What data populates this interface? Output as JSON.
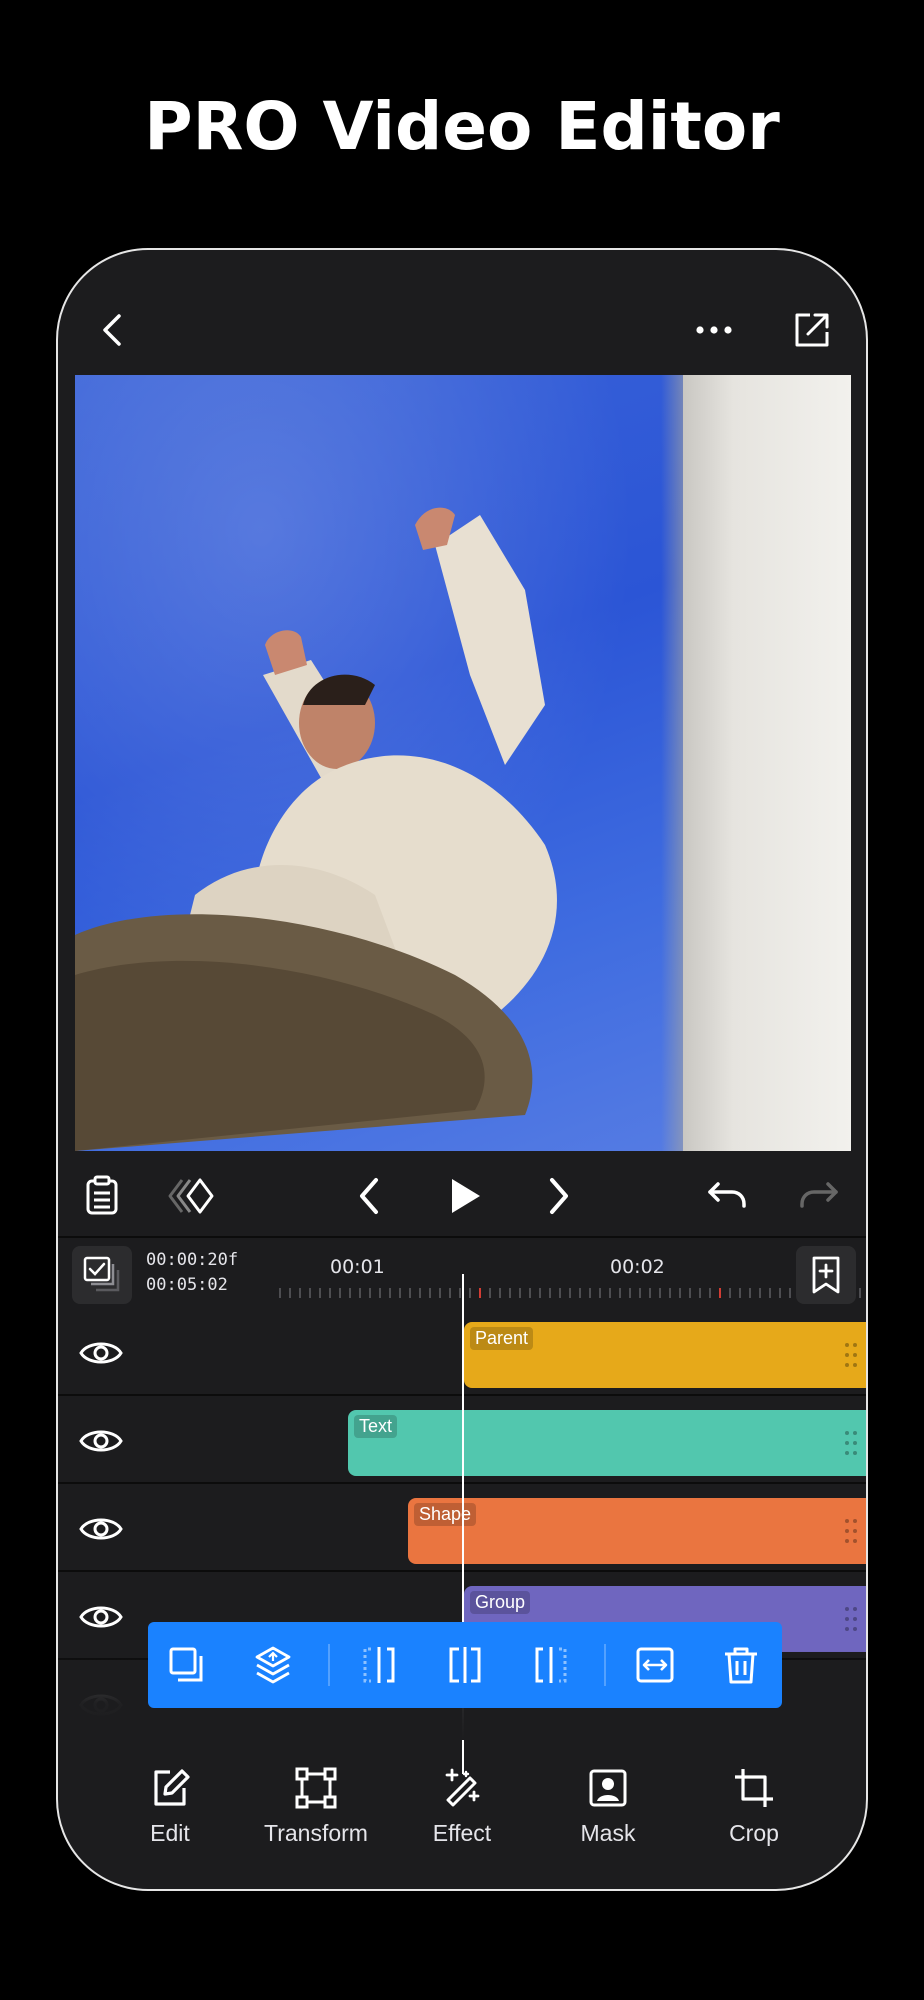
{
  "headline": "PRO Video Editor",
  "topbar": {
    "back_icon": "chevron-left-icon",
    "more_icon": "more-horizontal-icon",
    "share_icon": "export-share-icon"
  },
  "controls": {
    "clipboard_icon": "clipboard-icon",
    "keyframe_icon": "keyframe-diamond-icon",
    "prev_icon": "chevron-left-icon",
    "play_icon": "play-icon",
    "next_icon": "chevron-right-icon",
    "undo_icon": "undo-icon",
    "redo_icon": "redo-icon"
  },
  "ruler": {
    "current_time": "00:00:20f",
    "total_time": "00:05:02",
    "marks": [
      "00:01",
      "00:02"
    ]
  },
  "tracks": [
    {
      "label": "Parent",
      "color": "#e6a91a"
    },
    {
      "label": "Text",
      "color": "#52c7ae"
    },
    {
      "label": "Shape",
      "color": "#ea7540"
    },
    {
      "label": "Group",
      "color": "#6f66bf"
    }
  ],
  "selection_tools": [
    "duplicate-icon",
    "layer-order-icon",
    "trim-start-icon",
    "split-icon",
    "trim-end-icon",
    "fit-width-icon",
    "trash-icon"
  ],
  "bottom_tools": [
    {
      "label": "Edit",
      "icon": "edit-icon"
    },
    {
      "label": "Transform",
      "icon": "transform-icon"
    },
    {
      "label": "Effect",
      "icon": "magic-wand-icon"
    },
    {
      "label": "Mask",
      "icon": "mask-portrait-icon"
    },
    {
      "label": "Crop",
      "icon": "crop-icon"
    }
  ],
  "colors": {
    "accent": "#1a82ff",
    "panel": "#1c1c1e",
    "sky": "#2b55d6"
  }
}
